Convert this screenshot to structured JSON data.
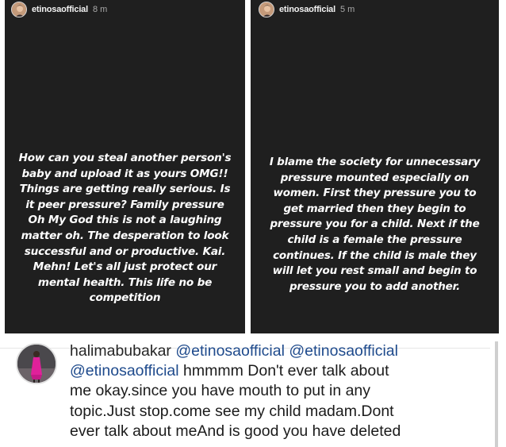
{
  "stories": [
    {
      "username": "etinosaofficial",
      "time": "8 m",
      "lines": [
        "How can you steal another person's",
        "baby and upload it as yours OMG!!",
        "Things are getting really serious. Is",
        "it peer pressure? Family pressure",
        "Oh My God this is not a laughing",
        "matter oh. The desperation to look",
        "successful and or productive. Kai.",
        "Mehn! Let's all just protect our",
        "mental health. This life no be",
        "competition"
      ]
    },
    {
      "username": "etinosaofficial",
      "time": "5 m",
      "lines": [
        "I blame the society for unnecessary",
        "pressure mounted especially on",
        "women. First they pressure you to",
        "get married then they begin to",
        "pressure you for a child. Next if the",
        "child is a female the pressure",
        "continues. If the child is male they",
        "will let you rest small and begin to",
        "pressure you to add another."
      ]
    }
  ],
  "comment": {
    "username": "halimabubakar",
    "mentions": [
      "@etinosaofficial",
      "@etinosaofficial",
      "@etinosaofficial"
    ],
    "lines": [
      "hmmmm Don't ever talk about",
      "me okay.since you have mouth to put in any",
      "topic.Just stop.come see my child madam.Dont",
      "ever talk about meAnd is good you have deleted"
    ]
  },
  "colors": {
    "story_bg": "#1f1f1f",
    "mention": "#1e4a8c",
    "comment_text": "#1b1b1b"
  }
}
